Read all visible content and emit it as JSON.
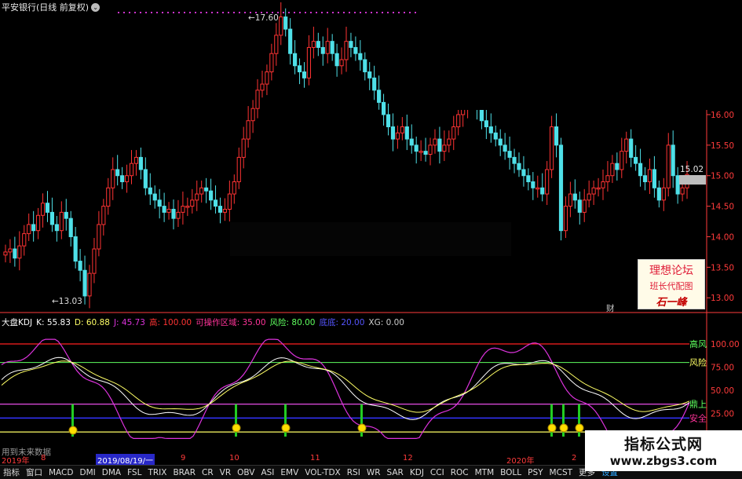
{
  "title": {
    "stock": "平安银行",
    "period": "(日线 前复权)"
  },
  "colors": {
    "bg": "#000000",
    "up": "#ff3333",
    "down": "#4fe0e8",
    "axis": "#ff3b3b",
    "grid": "#5a0000",
    "k": "#ffffff",
    "d": "#ffff66",
    "j": "#dd33dd",
    "high": "#ff2020",
    "risk": "#5fff5f",
    "safe": "#ff3399",
    "bottom": "#ff55ff",
    "lower": "#9898ff",
    "xg": "#aaaaaa",
    "accent": "#2828c8"
  },
  "price_axis": {
    "labels": [
      "16.00",
      "15.50",
      "15.00",
      "14.50",
      "14.00",
      "13.50",
      "13.00"
    ],
    "current": "15.02"
  },
  "indicator_axis": {
    "labels": [
      "100.00",
      "75.00",
      "50.00",
      "25.00"
    ]
  },
  "annotations": {
    "high": "17.60",
    "low": "13.03",
    "finance_mark": "财"
  },
  "indicator": {
    "name": "大盘KDJ",
    "items": [
      {
        "label": "K:",
        "value": "55.83",
        "color": "#ffffff"
      },
      {
        "label": "D:",
        "value": "60.88",
        "color": "#ffff66"
      },
      {
        "label": "J:",
        "value": "45.73",
        "color": "#dd33dd"
      },
      {
        "label": "高:",
        "value": "100.00",
        "color": "#ff3333"
      },
      {
        "label": "可操作区域:",
        "value": "35.00",
        "color": "#ff3399"
      },
      {
        "label": "风险:",
        "value": "80.00",
        "color": "#5fff5f"
      },
      {
        "label": "底底:",
        "value": "20.00",
        "color": "#5555ff"
      },
      {
        "label": "XG:",
        "value": "0.00",
        "color": "#cccccc"
      }
    ],
    "zone_labels": [
      {
        "text": "高风",
        "color": "#5fff5f"
      },
      {
        "text": "风险",
        "color": "#ffff66"
      },
      {
        "text": "鼎上",
        "color": "#5fff5f"
      },
      {
        "text": "安全",
        "color": "#ff3399"
      }
    ],
    "levels": {
      "high": 100,
      "risk": 80,
      "safe": 35,
      "bottom": 20,
      "lower": 5
    }
  },
  "future_note": "用到未来数据",
  "date_bar": {
    "ticks": [
      "2019年",
      "8",
      "9",
      "10",
      "11",
      "12",
      "2020年",
      "2"
    ],
    "highlight": "2019/08/19/一"
  },
  "tabs": [
    "指标",
    "窗口",
    "MACD",
    "DMI",
    "DMA",
    "FSL",
    "TRIX",
    "BRAR",
    "CR",
    "VR",
    "OBV",
    "ASI",
    "EMV",
    "VOL-TDX",
    "RSI",
    "WR",
    "SAR",
    "KDJ",
    "CCI",
    "ROC",
    "MTM",
    "BOLL",
    "PSY",
    "MCST",
    "更多",
    "设置"
  ],
  "active_tab": "设置",
  "notice": {
    "line1": "理想论坛",
    "line2": "班长代配图",
    "line3": "石一峰"
  },
  "watermark": {
    "line1": "指标公式网",
    "line2": "www.zbgs3.com"
  },
  "chart_data": {
    "type": "candlestick",
    "title": "平安银行 (日线 前复权)",
    "xlabel": "",
    "ylabel": "",
    "ylim": [
      12.9,
      17.8
    ],
    "series": [
      {
        "name": "price",
        "values": [
          13.75,
          13.8,
          13.65,
          13.85,
          14.05,
          14.2,
          14.1,
          14.35,
          14.55,
          14.4,
          14.2,
          14.1,
          14.4,
          14.3,
          14.0,
          13.6,
          13.45,
          13.03,
          13.4,
          13.8,
          14.2,
          14.5,
          14.8,
          15.1,
          15.0,
          14.9,
          15.0,
          15.2,
          15.3,
          15.1,
          14.8,
          14.7,
          14.6,
          14.5,
          14.4,
          14.45,
          14.3,
          14.4,
          14.5,
          14.5,
          14.6,
          14.7,
          14.8,
          14.75,
          14.6,
          14.5,
          14.4,
          14.45,
          14.7,
          14.9,
          15.3,
          15.6,
          15.9,
          16.1,
          16.4,
          16.5,
          16.7,
          17.0,
          17.3,
          17.6,
          17.4,
          17.0,
          16.8,
          16.7,
          16.6,
          17.1,
          17.2,
          17.1,
          17.0,
          17.2,
          17.0,
          16.8,
          16.9,
          17.2,
          17.1,
          17.0,
          16.9,
          16.7,
          16.6,
          16.4,
          16.2,
          16.0,
          15.8,
          15.6,
          15.7,
          15.8,
          15.6,
          15.5,
          15.4,
          15.4,
          15.35,
          15.5,
          15.6,
          15.4,
          15.5,
          15.6,
          15.8,
          16.0,
          16.1,
          16.2,
          16.3,
          16.1,
          15.9,
          15.8,
          15.7,
          15.6,
          15.5,
          15.4,
          15.3,
          15.2,
          15.1,
          15.0,
          14.9,
          14.8,
          14.8,
          14.7,
          15.1,
          15.8,
          15.5,
          14.1,
          14.5,
          14.7,
          14.6,
          14.4,
          14.6,
          14.7,
          14.8,
          14.8,
          14.9,
          15.0,
          15.2,
          15.1,
          15.4,
          15.6,
          15.3,
          15.2,
          15.0,
          14.9,
          15.1,
          14.8,
          14.6,
          14.8,
          15.5,
          15.0,
          14.7,
          14.8,
          15.02
        ]
      }
    ]
  }
}
